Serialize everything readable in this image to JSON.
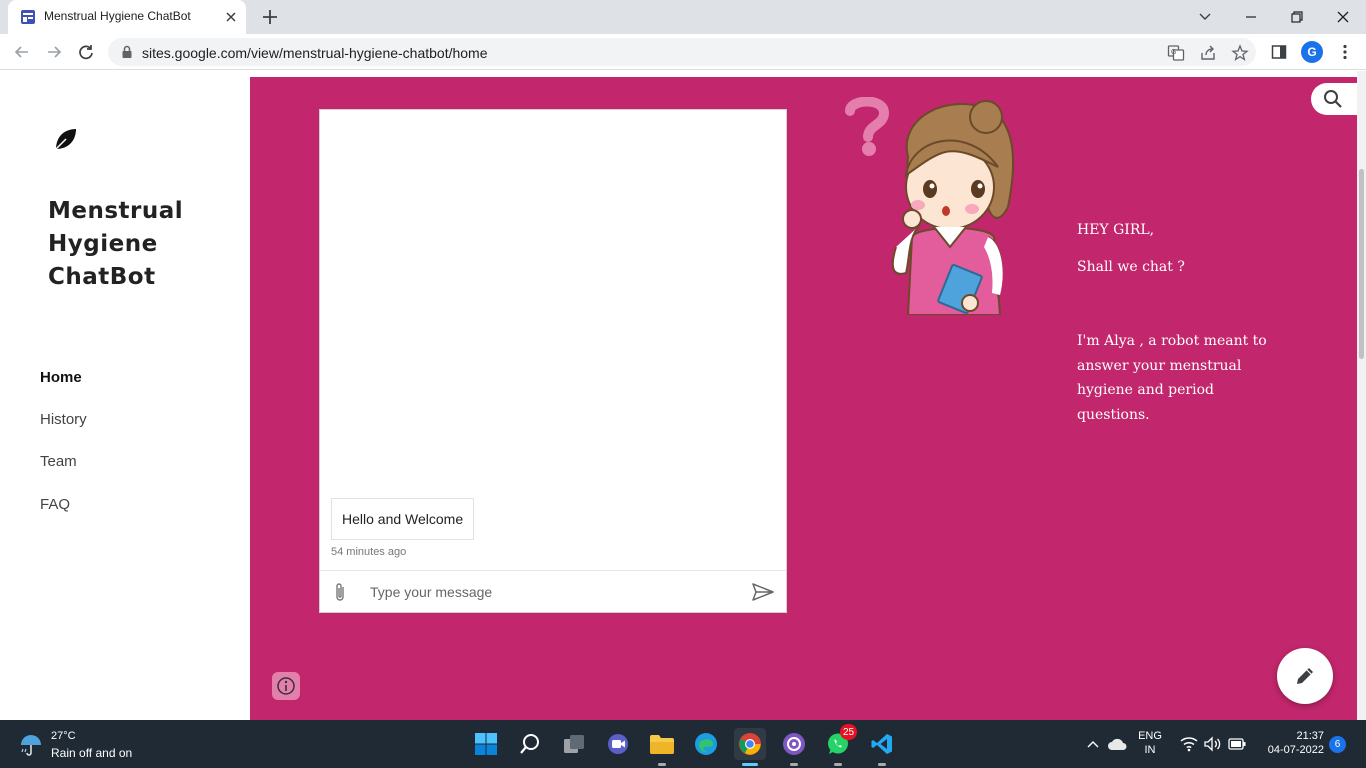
{
  "browser": {
    "tab_title": "Menstrual Hygiene ChatBot",
    "url": "sites.google.com/view/menstrual-hygiene-chatbot/home",
    "profile_initial": "G"
  },
  "site": {
    "title": "Menstrual Hygiene ChatBot",
    "nav": [
      {
        "label": "Home",
        "active": true
      },
      {
        "label": "History",
        "active": false
      },
      {
        "label": "Team",
        "active": false
      },
      {
        "label": "FAQ",
        "active": false
      }
    ]
  },
  "chat": {
    "message": "Hello and Welcome",
    "timestamp": "54 minutes ago",
    "input_placeholder": "Type your message"
  },
  "greeting": {
    "line1": "HEY GIRL,",
    "line2": "Shall we chat ?",
    "intro": "I'm Alya , a robot meant to answer your menstrual hygiene and  period questions."
  },
  "taskbar": {
    "weather_temp": "27°C",
    "weather_desc": "Rain off and on",
    "whatsapp_badge": "25",
    "lang_line1": "ENG",
    "lang_line2": "IN",
    "time": "21:37",
    "date": "04-07-2022",
    "notifications": "6"
  },
  "colors": {
    "page_bg": "#c2266c",
    "accent_pink": "#e47fad"
  }
}
